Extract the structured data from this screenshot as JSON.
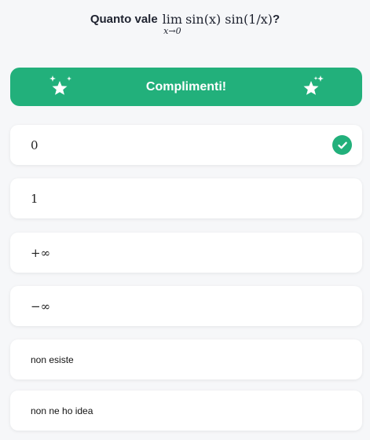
{
  "question": {
    "prefix": "Quanto vale",
    "lim": "lim",
    "lim_sub": "x→0",
    "expression": "sin(x) sin(1/x)",
    "suffix": "?"
  },
  "banner": {
    "text": "Complimenti!",
    "icon": "sparkle-star-icon",
    "color": "#22b07b"
  },
  "options": [
    {
      "label": "0",
      "style": "math",
      "correct": true,
      "icon": "check-circle-icon"
    },
    {
      "label": "1",
      "style": "math",
      "correct": false
    },
    {
      "label": "+∞",
      "style": "math",
      "correct": false
    },
    {
      "label": "−∞",
      "style": "math",
      "correct": false
    },
    {
      "label": "non esiste",
      "style": "plain",
      "correct": false
    },
    {
      "label": "non ne ho idea",
      "style": "plain",
      "correct": false
    }
  ]
}
